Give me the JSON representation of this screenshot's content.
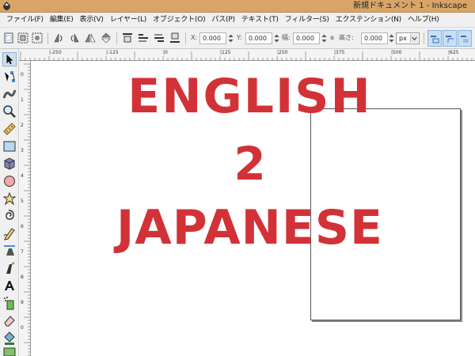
{
  "window": {
    "title": "新規ドキュメント 1 - Inkscape"
  },
  "menu": {
    "items": [
      {
        "label": "ファイル(F)"
      },
      {
        "label": "編集(E)"
      },
      {
        "label": "表示(V)"
      },
      {
        "label": "レイヤー(L)"
      },
      {
        "label": "オブジェクト(O)"
      },
      {
        "label": "パス(P)"
      },
      {
        "label": "テキスト(T)"
      },
      {
        "label": "フィルター(S)"
      },
      {
        "label": "エクステンション(N)"
      },
      {
        "label": "ヘルプ(H)"
      }
    ]
  },
  "toolbar": {
    "x_label": "X:",
    "x_value": "0.000",
    "y_label": "Y:",
    "y_value": "0.000",
    "w_label": "幅:",
    "w_value": "0.000",
    "lock_label": "a",
    "h_label": "高さ:",
    "h_value": "0.000",
    "unit": "px"
  },
  "rulers": {
    "h_ticks": [
      "|-250",
      "|-125",
      "|0",
      "|125",
      "|250",
      "|375",
      "|500",
      "|625"
    ],
    "v_ticks": [
      "0",
      "1",
      "2",
      "3",
      "4",
      "5",
      "6",
      "7",
      "8",
      "9",
      "0"
    ]
  },
  "canvas": {
    "art_line1": "ENGLISH",
    "art_line2": "2",
    "art_line3": "JAPANESE",
    "art_color": "#d23237"
  },
  "colors": {
    "titlebar": "#d8a468",
    "accent": "#c8def4"
  },
  "icons": {
    "tools": [
      "selector-arrow-icon",
      "node-editor-icon",
      "tweak-icon",
      "zoom-icon",
      "measure-icon",
      "rectangle-icon",
      "3d-box-icon",
      "ellipse-icon",
      "star-icon",
      "spiral-icon",
      "pencil-icon",
      "pen-icon",
      "calligraphy-icon",
      "text-icon",
      "spray-icon",
      "eraser-icon",
      "paint-bucket-icon",
      "gradient-icon"
    ]
  }
}
